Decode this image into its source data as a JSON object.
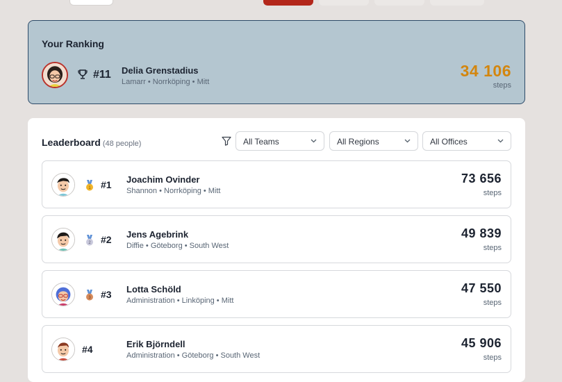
{
  "ranking": {
    "title": "Your Ranking",
    "rank": "#11",
    "name": "Delia Grenstadius",
    "meta": "Lamarr • Norrköping • Mitt",
    "score": "34 106",
    "unit": "steps",
    "accent_color": "#d3860f"
  },
  "leaderboard": {
    "title": "Leaderboard",
    "count": "(48 people)",
    "filters": {
      "teams": "All Teams",
      "regions": "All Regions",
      "offices": "All Offices"
    },
    "rows": [
      {
        "rank": "#1",
        "name": "Joachim Ovinder",
        "meta": "Shannon • Norrköping • Mitt",
        "score": "73 656",
        "unit": "steps",
        "medal": "gold-medal-icon"
      },
      {
        "rank": "#2",
        "name": "Jens Agebrink",
        "meta": "Diffie • Göteborg • South West",
        "score": "49 839",
        "unit": "steps",
        "medal": "silver-medal-icon"
      },
      {
        "rank": "#3",
        "name": "Lotta Schöld",
        "meta": "Administration • Linköping • Mitt",
        "score": "47 550",
        "unit": "steps",
        "medal": "bronze-medal-icon"
      },
      {
        "rank": "#4",
        "name": "Erik Björndell",
        "meta": "Administration • Göteborg • South West",
        "score": "45 906",
        "unit": "steps",
        "medal": ""
      }
    ]
  }
}
